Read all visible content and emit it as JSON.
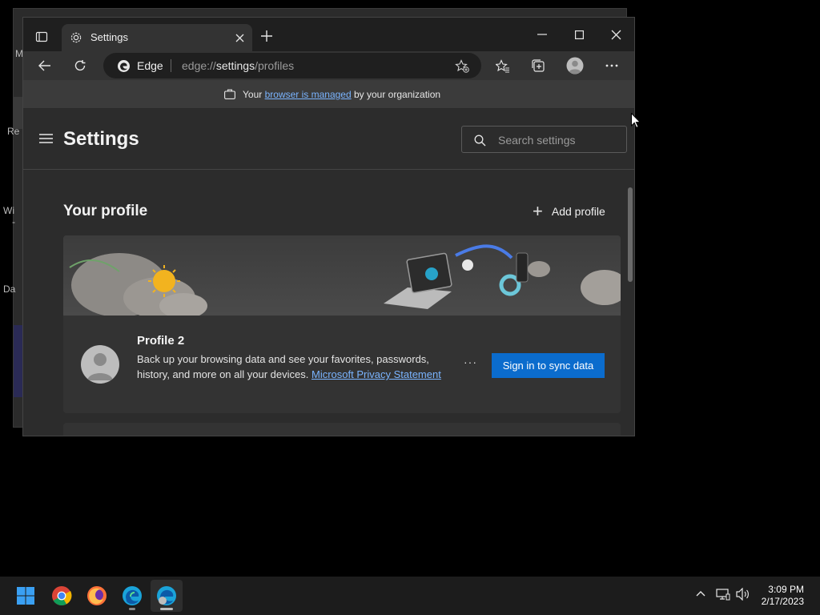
{
  "background_window": {
    "fragments": [
      "My",
      "Re",
      "Wi",
      "-",
      "Da"
    ]
  },
  "tab": {
    "title": "Settings"
  },
  "address": {
    "brand": "Edge",
    "url_prefix": "edge://",
    "url_bold": "settings",
    "url_suffix": "/profiles"
  },
  "infobar": {
    "prefix": "Your ",
    "link": "browser is managed",
    "suffix": " by your organization"
  },
  "settings": {
    "title": "Settings",
    "search_placeholder": "Search settings"
  },
  "profile_section": {
    "heading": "Your profile",
    "add_label": "Add profile",
    "profile_name": "Profile 2",
    "description": "Back up your browsing data and see your favorites, passwords, history, and more on all your devices.",
    "link": "Microsoft Privacy Statement",
    "more": "···",
    "sync_label": "Sign in to sync data"
  },
  "taskbar": {
    "time": "3:09 PM",
    "date": "2/17/2023"
  },
  "colors": {
    "accent": "#0b6ccd",
    "link": "#7ab4ff"
  }
}
